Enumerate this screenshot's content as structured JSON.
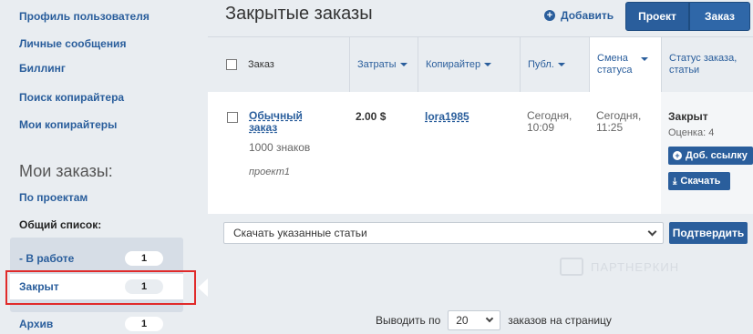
{
  "sidebar": {
    "links": [
      {
        "label": "Профиль пользователя"
      },
      {
        "label": "Личные сообщения"
      },
      {
        "label": "Биллинг"
      },
      {
        "label": "Поиск копирайтера"
      },
      {
        "label": "Мои копирайтеры"
      }
    ],
    "section_title": "Мои заказы:",
    "by_projects": "По проектам",
    "general_list": "Общий список:",
    "statuses": [
      {
        "label": "- В работе",
        "count": "1"
      },
      {
        "label": "Закрыт",
        "count": "1"
      },
      {
        "label": "Архив",
        "count": "1"
      }
    ]
  },
  "header": {
    "title": "Закрытые заказы",
    "add_label": "Добавить",
    "add_icon": "plus-circle-icon",
    "segment": [
      "Проект",
      "Заказ"
    ]
  },
  "table": {
    "columns": {
      "order": "Заказ",
      "cost": "Затраты",
      "copywriter": "Копирайтер",
      "published": "Публ.",
      "status_change_1": "Смена",
      "status_change_2": "статуса",
      "status_1": "Статус заказа,",
      "status_2": "статьи"
    },
    "row": {
      "title_1": "Обычный",
      "title_2": "заказ",
      "chars": "1000 знаков",
      "project": "проект1",
      "cost": "2.00 $",
      "copywriter": "lora1985",
      "published_1": "Сегодня,",
      "published_2": "10:09",
      "changed_1": "Сегодня,",
      "changed_2": "11:25",
      "status": "Закрыт",
      "rating": "Оценка: 4",
      "add_link_btn": "Доб. ссылку",
      "download_btn": "Скачать"
    }
  },
  "actions": {
    "select_value": "Скачать указанные статьи",
    "confirm": "Подтвердить"
  },
  "watermark": "ПАРТНЕРКИН",
  "pager": {
    "prefix": "Выводить по",
    "value": "20",
    "suffix": "заказов на страницу"
  },
  "colors": {
    "accent": "#2a5e9c",
    "highlight": "#e02a2a",
    "sidebar_bg": "#e9edf1"
  }
}
